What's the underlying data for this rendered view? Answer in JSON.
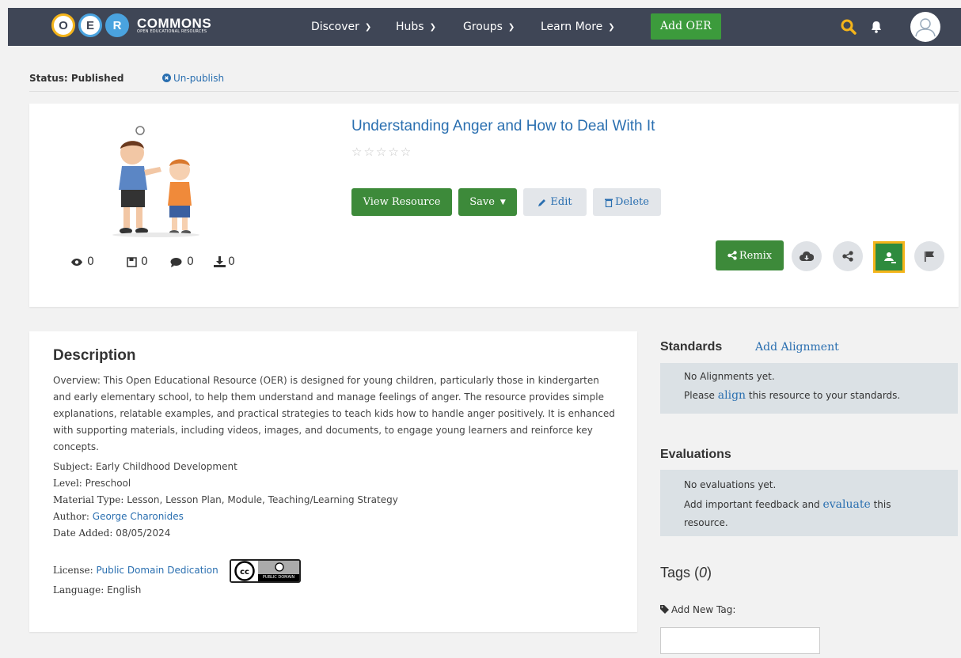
{
  "nav": {
    "logo_letters": [
      "O",
      "E",
      "R"
    ],
    "logo_title": "COMMONS",
    "logo_subtitle": "OPEN EDUCATIONAL RESOURCES",
    "menu": [
      {
        "label": "Discover"
      },
      {
        "label": "Hubs"
      },
      {
        "label": "Groups"
      },
      {
        "label": "Learn More"
      }
    ],
    "add_oer": "Add OER",
    "icons": [
      "search-icon",
      "bell-icon",
      "user-avatar-icon"
    ]
  },
  "status": {
    "label": "Status: Published",
    "unpublish": "Un-publish"
  },
  "resource": {
    "title": "Understanding Anger and How to Deal With It",
    "rating": "0 of 5 stars",
    "stars": "☆☆☆☆☆",
    "buttons": {
      "view": "View Resource",
      "save": "Save",
      "edit": "Edit",
      "delete": "Delete",
      "remix": "Remix"
    },
    "stats": {
      "views": "0",
      "saves": "0",
      "comments": "0",
      "downloads": "0"
    },
    "action_icons": [
      "cloud-download-icon",
      "share-icon",
      "google-classroom-icon",
      "flag-icon"
    ]
  },
  "description": {
    "heading": "Description",
    "overview": "Overview: This Open Educational Resource (OER) is designed for young children, particularly those in kindergarten and early elementary school, to help them understand and manage feelings of anger. The resource provides simple explanations, relatable examples, and practical strategies to teach kids how to handle anger positively. It is enhanced with supporting materials, including videos, images, and documents, to engage young learners and reinforce key concepts.",
    "subject_label": "Subject:",
    "subject": "Early Childhood Development",
    "level_label": "Level:",
    "level": "Preschool",
    "material_label": "Material Type:",
    "material": "Lesson, Lesson Plan, Module, Teaching/Learning Strategy",
    "author_label": "Author:",
    "author": "George Charonides",
    "date_label": "Date Added:",
    "date": "08/05/2024",
    "license_label": "License:",
    "license": "Public Domain Dedication",
    "license_badge": "PUBLIC DOMAIN",
    "language_label": "Language:",
    "language": "English"
  },
  "standards": {
    "heading": "Standards",
    "add": "Add Alignment",
    "line1": "No Alignments yet.",
    "line2_a": "Please ",
    "line2_link": "align",
    "line2_b": " this resource to your standards."
  },
  "evaluations": {
    "heading": "Evaluations",
    "line1": "No evaluations yet.",
    "line2_a": "Add important feedback and ",
    "line2_link": "evaluate",
    "line2_b": " this",
    "line3": "resource."
  },
  "tags": {
    "heading": "Tags",
    "count": "0",
    "add_label": "Add New Tag:"
  },
  "colors": {
    "nav_bg": "#3f4656",
    "green": "#3d8a3a",
    "link": "#2a6fb0",
    "accent": "#f4b41a"
  }
}
